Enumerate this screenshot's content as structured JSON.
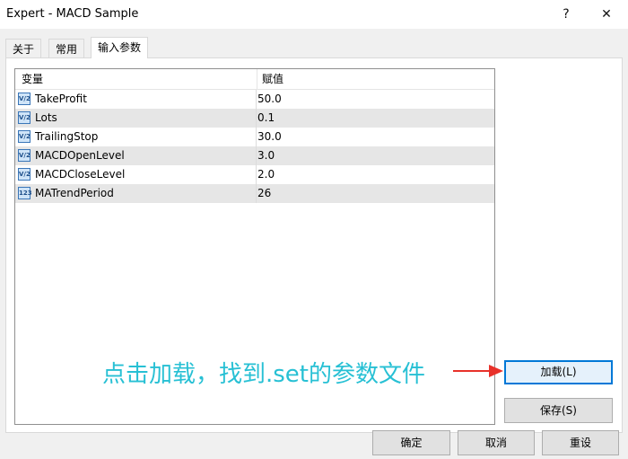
{
  "window": {
    "title": "Expert - MACD Sample",
    "help_glyph": "?",
    "close_glyph": "✕"
  },
  "tabs": [
    {
      "label": "关于",
      "active": false
    },
    {
      "label": "常用",
      "active": false
    },
    {
      "label": "输入参数",
      "active": true
    }
  ],
  "table": {
    "headers": [
      "变量",
      "赋值"
    ],
    "rows": [
      {
        "icon": "V/2",
        "name": "TakeProfit",
        "value": "50.0",
        "icon_type": "real-value-icon"
      },
      {
        "icon": "V/2",
        "name": "Lots",
        "value": "0.1",
        "icon_type": "real-value-icon"
      },
      {
        "icon": "V/2",
        "name": "TrailingStop",
        "value": "30.0",
        "icon_type": "real-value-icon"
      },
      {
        "icon": "V/2",
        "name": "MACDOpenLevel",
        "value": "3.0",
        "icon_type": "real-value-icon"
      },
      {
        "icon": "V/2",
        "name": "MACDCloseLevel",
        "value": "2.0",
        "icon_type": "real-value-icon"
      },
      {
        "icon": "123",
        "name": "MATrendPeriod",
        "value": "26",
        "icon_type": "integer-value-icon"
      }
    ]
  },
  "side_buttons": {
    "load": "加载(L)",
    "save": "保存(S)"
  },
  "bottom_buttons": {
    "ok": "确定",
    "cancel": "取消",
    "reset": "重设"
  },
  "annotation": {
    "text": "点击加载，找到.set的参数文件",
    "color": "#27c0d4",
    "arrow_color": "#e8312a"
  }
}
